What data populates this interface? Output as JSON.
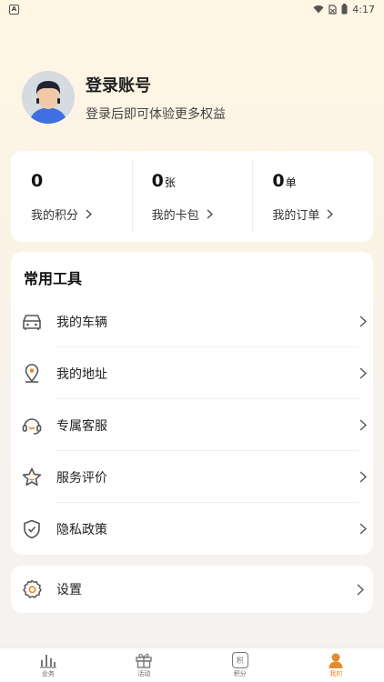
{
  "status": {
    "time": "4:17",
    "left_badge": "A"
  },
  "profile": {
    "title": "登录账号",
    "subtitle": "登录后即可体验更多权益"
  },
  "stats": [
    {
      "value": "0",
      "unit": "",
      "label": "我的积分"
    },
    {
      "value": "0",
      "unit": "张",
      "label": "我的卡包"
    },
    {
      "value": "0",
      "unit": "单",
      "label": "我的订单"
    }
  ],
  "tools": {
    "title": "常用工具",
    "items": [
      {
        "label": "我的车辆",
        "icon": "car-icon"
      },
      {
        "label": "我的地址",
        "icon": "location-icon"
      },
      {
        "label": "专属客服",
        "icon": "headset-icon"
      },
      {
        "label": "服务评价",
        "icon": "star-icon"
      },
      {
        "label": "隐私政策",
        "icon": "shield-icon"
      }
    ]
  },
  "settings": {
    "label": "设置",
    "icon": "gear-icon"
  },
  "nav": [
    {
      "label": "业务",
      "icon": "chart-icon"
    },
    {
      "label": "活动",
      "icon": "gift-icon"
    },
    {
      "label": "积分",
      "icon": "points-icon",
      "badge": "积"
    },
    {
      "label": "我的",
      "icon": "user-icon",
      "active": true
    }
  ],
  "colors": {
    "accent": "#e58a2a",
    "icon": "#555555"
  }
}
